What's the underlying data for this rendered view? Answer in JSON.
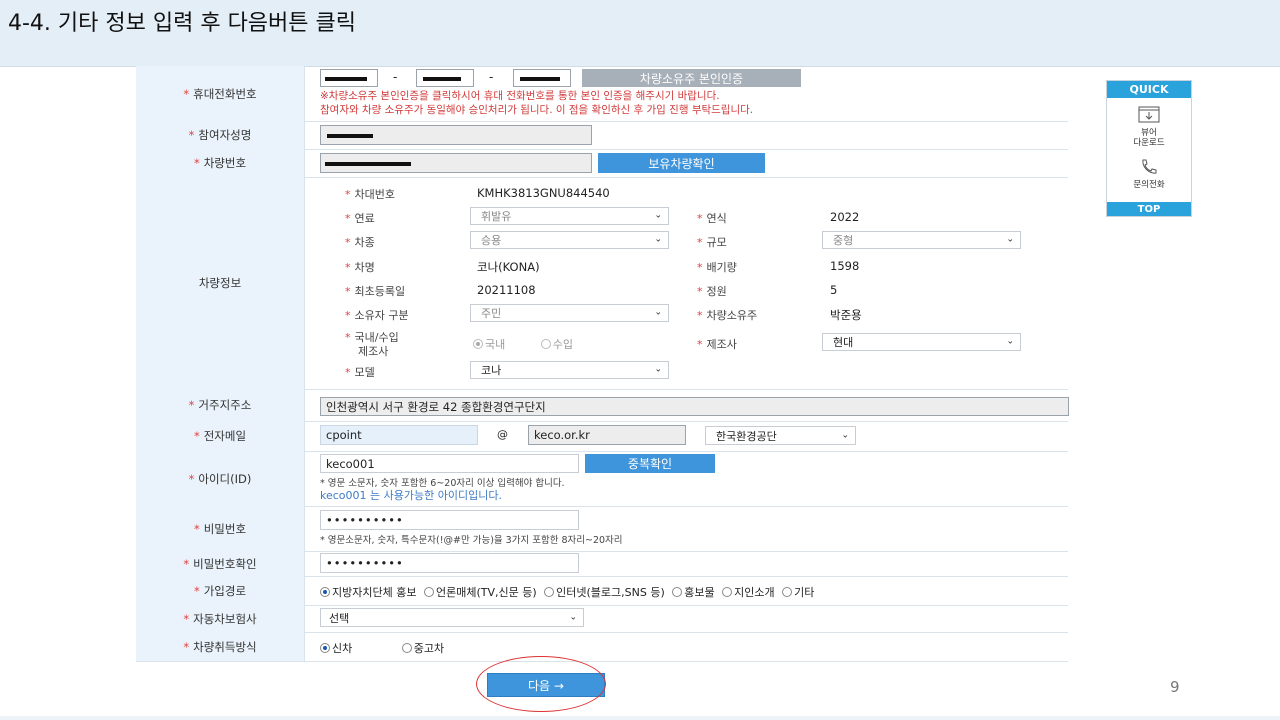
{
  "slide": {
    "title": "4-4. 기타 정보 입력 후 다음버튼 클릭",
    "page_number": "9"
  },
  "form": {
    "phone": {
      "label": "휴대전화번호",
      "dash": "-",
      "verify_button": "차량소유주 본인인증",
      "notice_line1": "※차량소유주 본인인증을 클릭하시어 휴대 전화번호를 통한 본인 인증을 해주시기 바랍니다.",
      "notice_line2": "참여자와 차량 소유주가 동일해야 승인처리가 됩니다. 이 점을 확인하신 후 가입 진행 부탁드립니다."
    },
    "name": {
      "label": "참여자성명"
    },
    "car_number": {
      "label": "차량번호",
      "check_button": "보유차량확인"
    },
    "vehicle": {
      "label": "차량정보",
      "vin_label": "차대번호",
      "vin": "KMHK3813GNU844540",
      "fuel_label": "연료",
      "fuel": "휘발유",
      "year_label": "연식",
      "year": "2022",
      "type_label": "차종",
      "type": "승용",
      "size_label": "규모",
      "size": "중형",
      "model_name_label": "차명",
      "model_name": "코나(KONA)",
      "displacement_label": "배기량",
      "displacement": "1598",
      "reg_date_label": "최초등록일",
      "reg_date": "20211108",
      "capacity_label": "정원",
      "capacity": "5",
      "owner_type_label": "소유자 구분",
      "owner_type": "주민",
      "owner_label": "차량소유주",
      "owner": "박준용",
      "origin_label_1": "국내/수입",
      "origin_label_2": "제조사",
      "origin_domestic": "국내",
      "origin_import": "수입",
      "maker_label": "제조사",
      "maker": "현대",
      "model_label": "모델",
      "model": "코나"
    },
    "address": {
      "label": "거주지주소",
      "value": "인천광역시 서구 환경로 42 종합환경연구단지"
    },
    "email": {
      "label": "전자메일",
      "local": "cpoint",
      "at": "@",
      "domain": "keco.or.kr",
      "domain_select": "한국환경공단"
    },
    "user_id": {
      "label": "아이디(ID)",
      "value": "keco001",
      "check_button": "중복확인",
      "hint": "* 영문 소문자, 숫자 포함한 6~20자리 이상 입력해야 합니다.",
      "ok_message": "keco001 는 사용가능한 아이디입니다."
    },
    "password": {
      "label": "비밀번호",
      "value": "••••••••••",
      "hint": "* 영문소문자, 숫자, 특수문자(!@#만 가능)을 3가지 포함한 8자리~20자리"
    },
    "password_confirm": {
      "label": "비밀번호확인",
      "value": "••••••••••"
    },
    "join_path": {
      "label": "가입경로",
      "options": [
        "지방자치단체 홍보",
        "언론매체(TV,신문 등)",
        "인터넷(블로그,SNS 등)",
        "홍보물",
        "지인소개",
        "기타"
      ]
    },
    "insurer": {
      "label": "자동차보험사",
      "value": "선택"
    },
    "acquisition": {
      "label": "차량취득방식",
      "new": "신차",
      "used": "중고차"
    },
    "required_mark": "*"
  },
  "next_button": "다음 →",
  "quick_menu": {
    "title": "QUICK",
    "viewer_1": "뷰어",
    "viewer_2": "다운로드",
    "call": "문의전화",
    "top": "TOP"
  }
}
